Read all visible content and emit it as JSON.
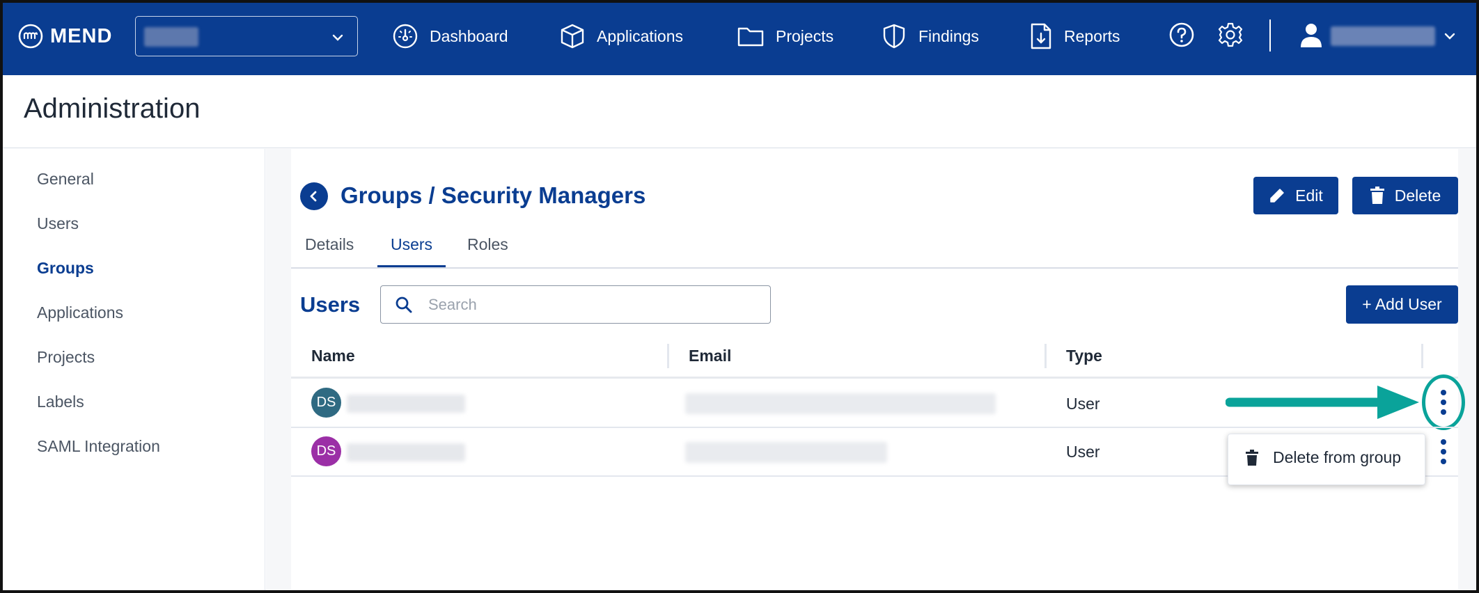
{
  "topbar": {
    "brand": "MEND",
    "nav": [
      {
        "label": "Dashboard",
        "icon": "dashboard-gauge-icon"
      },
      {
        "label": "Applications",
        "icon": "cube-icon"
      },
      {
        "label": "Projects",
        "icon": "folder-icon"
      },
      {
        "label": "Findings",
        "icon": "shield-icon"
      },
      {
        "label": "Reports",
        "icon": "report-download-icon"
      }
    ],
    "colors": {
      "bar": "#0a3d91",
      "accent": "#0aa39a"
    }
  },
  "header": {
    "title": "Administration"
  },
  "sidebar": {
    "items": [
      {
        "label": "General"
      },
      {
        "label": "Users"
      },
      {
        "label": "Groups",
        "active": true
      },
      {
        "label": "Applications"
      },
      {
        "label": "Projects"
      },
      {
        "label": "Labels"
      },
      {
        "label": "SAML Integration"
      }
    ]
  },
  "page": {
    "title": "Groups / Security Managers",
    "edit_label": "Edit",
    "delete_label": "Delete",
    "tabs": [
      {
        "label": "Details"
      },
      {
        "label": "Users",
        "active": true
      },
      {
        "label": "Roles"
      }
    ]
  },
  "users_section": {
    "title": "Users",
    "search_placeholder": "Search",
    "add_label": "+ Add User",
    "columns": [
      "Name",
      "Email",
      "Type"
    ],
    "rows": [
      {
        "initials": "DS",
        "avatar_color": "#2f6a82",
        "type": "User"
      },
      {
        "initials": "DS",
        "avatar_color": "#9b2fa6",
        "type": "User"
      }
    ]
  },
  "row_menu": {
    "delete_label": "Delete from group"
  }
}
